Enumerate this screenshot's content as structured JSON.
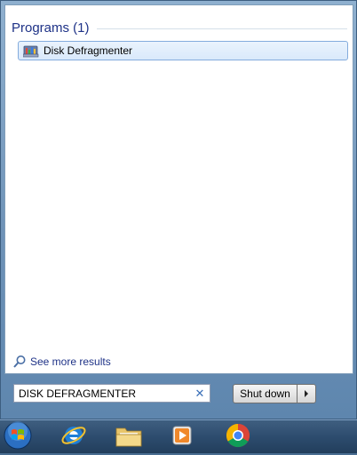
{
  "results": {
    "section_title": "Programs (1)",
    "items": [
      {
        "label": "Disk Defragmenter",
        "icon": "disk-defragmenter-icon"
      }
    ]
  },
  "see_more": {
    "label": "See more results",
    "icon": "search-icon"
  },
  "search": {
    "value": "DISK DEFRAGMENTER",
    "clear_icon": "clear-icon"
  },
  "shutdown": {
    "label": "Shut down",
    "arrow_icon": "arrow-right-icon"
  },
  "taskbar": {
    "items": [
      {
        "name": "start-button",
        "icon": "windows-orb-icon"
      },
      {
        "name": "internet-explorer",
        "icon": "internet-explorer-icon"
      },
      {
        "name": "file-explorer",
        "icon": "folder-icon"
      },
      {
        "name": "media-player",
        "icon": "media-player-icon"
      },
      {
        "name": "chrome",
        "icon": "chrome-icon"
      }
    ]
  },
  "colors": {
    "accent_text": "#1e3287",
    "selection_bg": "#d9e9fb",
    "selection_border": "#84acdd",
    "taskbar": "#2d4c6e"
  }
}
